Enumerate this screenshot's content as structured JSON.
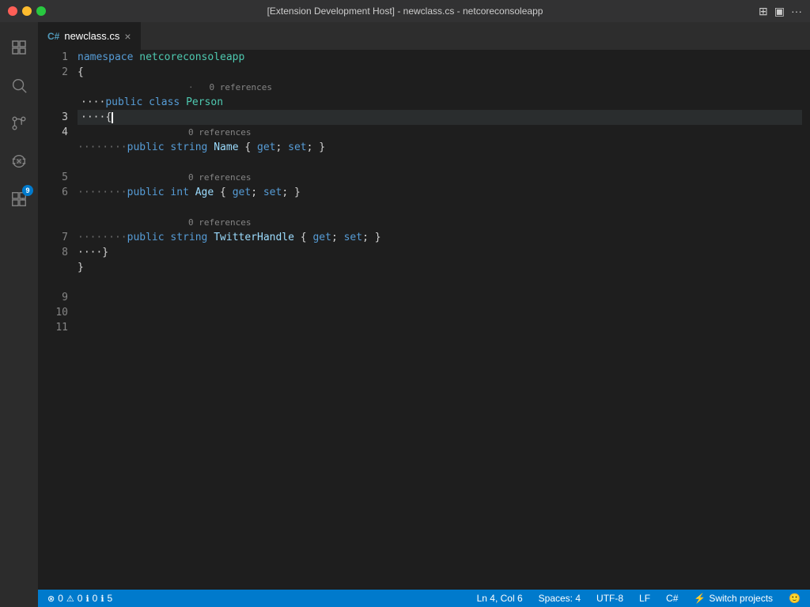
{
  "window": {
    "title": "[Extension Development Host] - newclass.cs - netcoreconsoleapp",
    "tab_label": "newclass.cs"
  },
  "title_bar": {
    "close_label": "●",
    "minimize_label": "●",
    "maximize_label": "●"
  },
  "activity_bar": {
    "items": [
      {
        "name": "explorer",
        "icon": "⊞",
        "active": false
      },
      {
        "name": "search",
        "icon": "🔍",
        "active": false
      },
      {
        "name": "source-control",
        "icon": "⎇",
        "active": false
      },
      {
        "name": "debug",
        "icon": "▶",
        "active": false
      },
      {
        "name": "extensions",
        "icon": "⊡",
        "active": false,
        "badge": "9"
      }
    ]
  },
  "editor": {
    "filename": "newclass.cs",
    "lines": [
      {
        "num": 1,
        "content": "namespace netcoreconsoleapp",
        "type": "code"
      },
      {
        "num": 2,
        "content": "{",
        "type": "code"
      },
      {
        "num": 3,
        "content": "    public class Person",
        "type": "code",
        "hasRef": true,
        "refText": "0 references"
      },
      {
        "num": 4,
        "content": "    {",
        "type": "code",
        "cursor": true
      },
      {
        "num": 5,
        "content": "        public string Name { get; set; }",
        "type": "code",
        "hasRef": true,
        "refText": "0 references"
      },
      {
        "num": 6,
        "content": "",
        "type": "code"
      },
      {
        "num": 7,
        "content": "        public int Age { get; set; }",
        "type": "code",
        "hasRef": true,
        "refText": "0 references"
      },
      {
        "num": 8,
        "content": "",
        "type": "code"
      },
      {
        "num": 9,
        "content": "        public string TwitterHandle { get; set; }",
        "type": "code",
        "hasRef": true,
        "refText": "0 references"
      },
      {
        "num": 10,
        "content": "    }",
        "type": "code"
      },
      {
        "num": 11,
        "content": "}",
        "type": "code"
      }
    ]
  },
  "status_bar": {
    "errors": "0",
    "warnings": "0",
    "info": "0",
    "info2": "5",
    "position": "Ln 4, Col 6",
    "spaces": "Spaces: 4",
    "encoding": "UTF-8",
    "line_ending": "LF",
    "language": "C#",
    "switch_projects": "Switch projects",
    "smiley": "🙂"
  }
}
